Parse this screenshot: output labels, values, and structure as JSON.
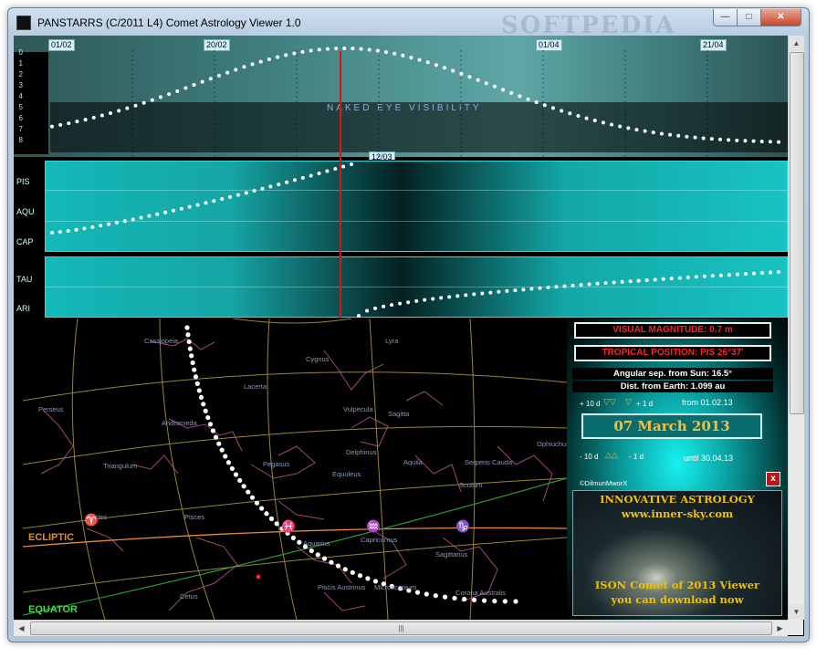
{
  "window": {
    "title": "PANSTARRS (C/2011 L4) Comet Astrology Viewer 1.0",
    "watermark": "SOFTPEDIA",
    "controls": {
      "minimize": "—",
      "maximize": "□",
      "close": "✕"
    }
  },
  "magnitude_chart": {
    "date_labels": [
      "01/02",
      "20/02",
      "01/04",
      "21/04"
    ],
    "current_date_label": "12/03",
    "scale_ticks": [
      "0",
      "1",
      "2",
      "3",
      "4",
      "5",
      "6",
      "7",
      "8"
    ],
    "visibility_label": "NAKED EYE VISIBILITY"
  },
  "zodiac_bands": {
    "band1_labels": [
      "PIS",
      "AQU",
      "CAP"
    ],
    "band2_labels": [
      "TAU",
      "ARI"
    ]
  },
  "sky_map": {
    "constellations": [
      "Cassiopeia",
      "Cygnus",
      "Lyra",
      "Lacerta",
      "Andromeda",
      "Perseus",
      "Vulpecula",
      "Sagitta",
      "Delphinus",
      "Triangulum",
      "Pegasus",
      "Equuleus",
      "Aquila",
      "Serpens Cauda",
      "Scutum",
      "Ophiuchus",
      "Aries",
      "Pisces",
      "Aquarius",
      "Capricornus",
      "Sagittarius",
      "Cetus",
      "Piscis Austrinus",
      "Microscopium",
      "Corona Australis"
    ],
    "ecliptic_label": "ECLIPTIC",
    "equator_label": "EQUATOR",
    "sign_glyphs": [
      "♈",
      "♓",
      "♒",
      "♑"
    ]
  },
  "info_panel": {
    "visual_magnitude": "VISUAL MAGNITUDE:  0.7 m",
    "tropical_position": "TROPICAL POSITION:  PIS 26°37ʹ",
    "angular_sep": "Angular sep. from Sun:  16.5°",
    "dist_earth": "Dist. from Earth:  1.099 au",
    "step_plus_10": "+ 10 d",
    "step_plus_1": "+ 1 d",
    "step_minus_10": "- 10 d",
    "step_minus_1": "- 1 d",
    "from_date": "from 01.02.13",
    "until_date": "until 30.04.13",
    "current_date": "07 March 2013",
    "credit": "©DilmunMworX",
    "close": "x"
  },
  "ad": {
    "line1": "INNOVATIVE ASTROLOGY",
    "line2": "www.inner-sky.com",
    "line3": "ISON Comet of 2013 Viewer",
    "line4": "you can download now"
  },
  "colors": {
    "accent_red": "#e21212",
    "band_cyan": "#13b9b9",
    "panel_cyan": "#18f0f0",
    "date_gold": "#f2c040",
    "ecliptic": "#e88a3a",
    "equator": "#48d848"
  }
}
